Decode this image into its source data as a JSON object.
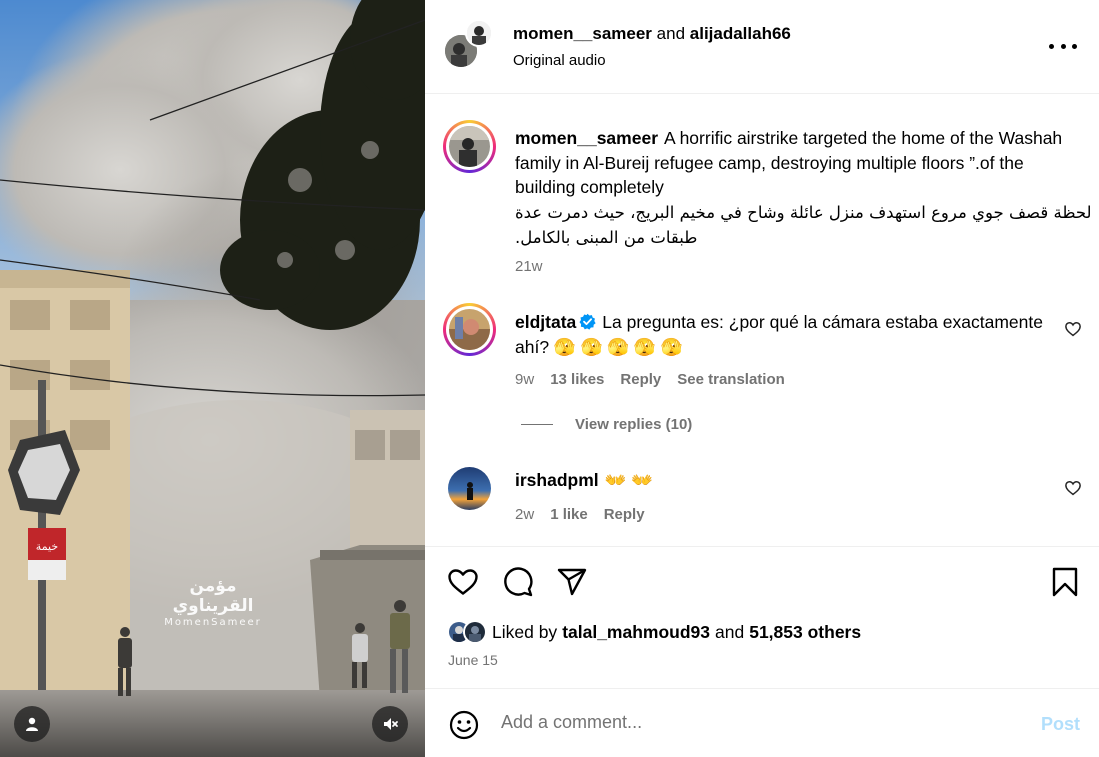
{
  "media": {
    "watermark_ar": "مؤمن القريناوي",
    "watermark_en": "MomenSameer",
    "sign_text": "خيمة",
    "icons": {
      "user": "user-icon",
      "mute": "speaker-muted-icon"
    }
  },
  "header": {
    "author": "momen__sameer",
    "joiner": "and",
    "collaborator": "alijadallah66",
    "audio": "Original audio"
  },
  "caption": {
    "username": "momen__sameer",
    "text_en": "A horrific airstrike targeted the home of the Washah family in Al-Bureij refugee camp, destroying multiple floors ”.of the building completely",
    "text_ar": "لحظة قصف جوي مروع استهدف منزل عائلة وشاح في مخيم البريج، حيث دمرت عدة طبقات من المبنى بالكامل.",
    "age": "21w"
  },
  "comments": [
    {
      "username": "eldjtata",
      "verified": true,
      "text": "La pregunta es: ¿por qué la cámara estaba exactamente ahí? 🫣 🫣 🫣 🫣 🫣",
      "age": "9w",
      "likes": "13 likes",
      "reply": "Reply",
      "translate": "See translation",
      "view_replies": "View replies (10)"
    },
    {
      "username": "irshadpml",
      "text": "👐 👐",
      "age": "2w",
      "likes": "1 like",
      "reply": "Reply"
    }
  ],
  "actions": {
    "icons": [
      "heart-icon",
      "comment-icon",
      "share-icon",
      "bookmark-icon"
    ]
  },
  "likes": {
    "prefix": "Liked by",
    "user": "talal_mahmoud93",
    "joiner": "and",
    "others": "51,853 others",
    "date": "June 15"
  },
  "comment_box": {
    "placeholder": "Add a comment...",
    "post_label": "Post"
  },
  "colors": {
    "muted": "#737373",
    "post_disabled": "#b2dffc",
    "verified": "#0095f6"
  }
}
